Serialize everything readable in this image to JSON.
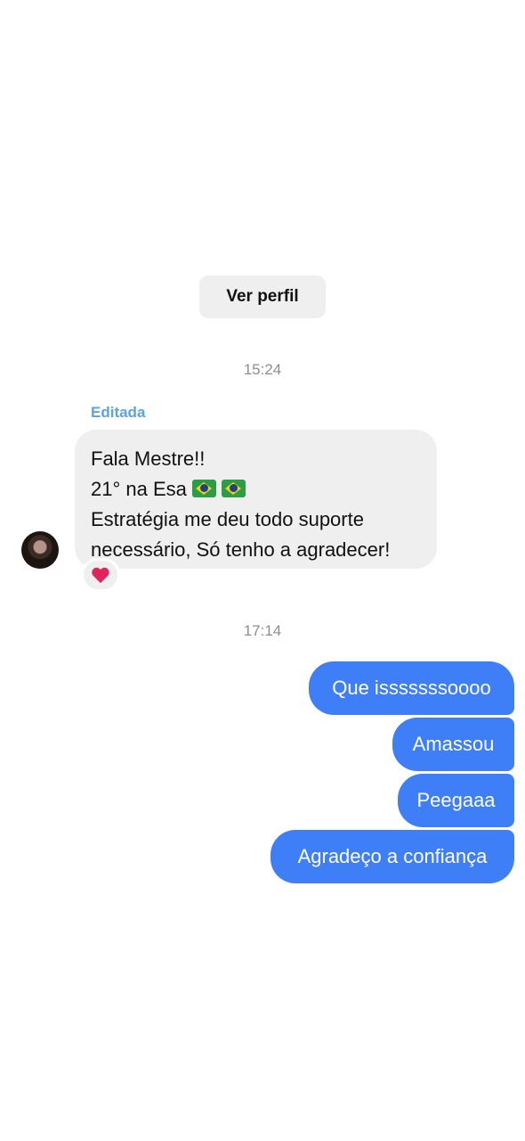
{
  "header": {
    "profile_button": "Ver perfil"
  },
  "timestamps": {
    "first": "15:24",
    "second": "17:14"
  },
  "incoming": {
    "edited_label": "Editada",
    "lines": [
      "Fala Mestre!!",
      "21° na Esa",
      "Estratégia me deu todo suporte",
      "necessário, Só tenho a agradecer!"
    ],
    "reaction": "heart-icon"
  },
  "outgoing": [
    "Que isssssssoooo",
    "Amassou",
    "Peegaaa",
    "Agradeço a confiança"
  ],
  "colors": {
    "outgoing_bubble": "#3e7ef7",
    "incoming_bubble": "#efefef",
    "edited_label": "#5aa4dc",
    "timestamp": "#8e8e8e",
    "heart": "#e0245e"
  }
}
